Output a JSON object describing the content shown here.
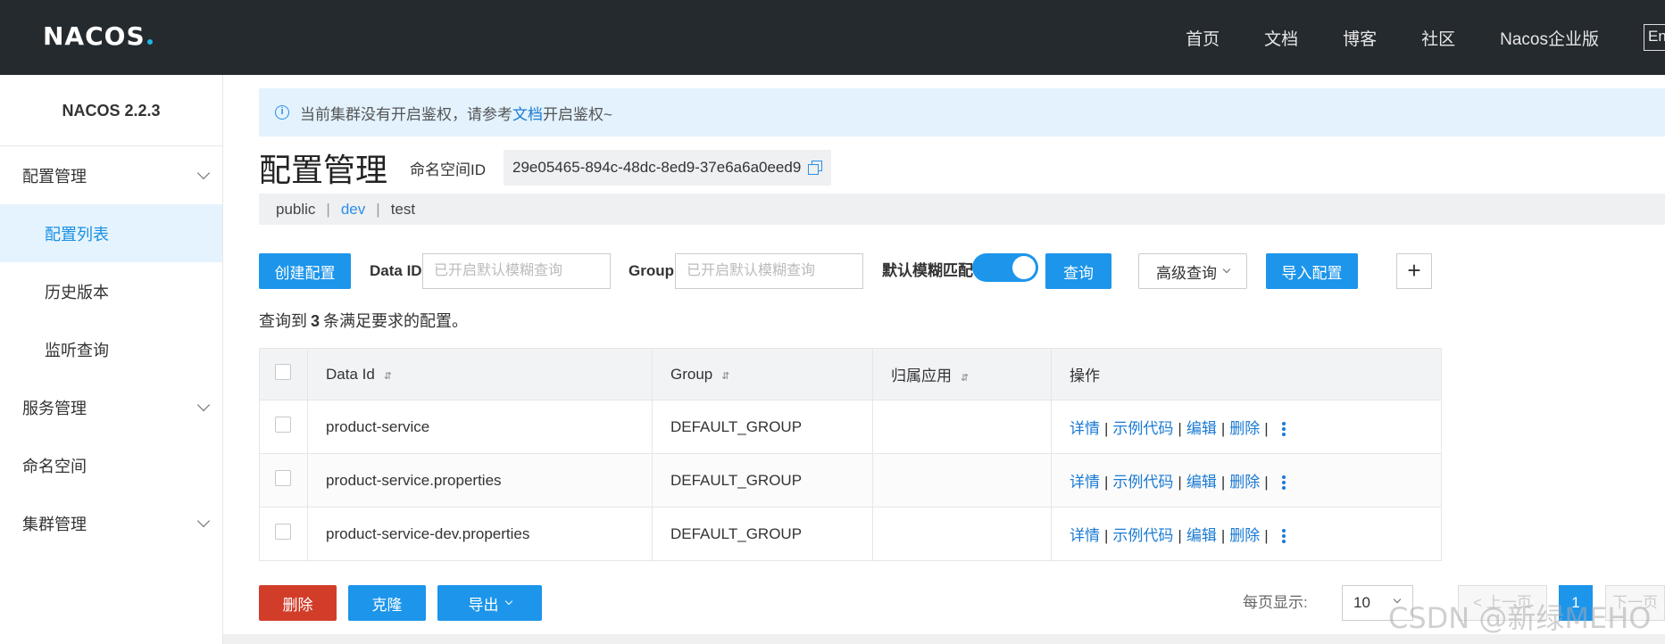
{
  "header": {
    "logo": "NACOS",
    "nav": [
      "首页",
      "文档",
      "博客",
      "社区",
      "Nacos企业版"
    ],
    "lang": "En"
  },
  "sidebar": {
    "version": "NACOS 2.2.3",
    "items": [
      {
        "label": "配置管理",
        "expandable": true
      },
      {
        "label": "配置列表",
        "sub": true,
        "active": true
      },
      {
        "label": "历史版本",
        "sub": true
      },
      {
        "label": "监听查询",
        "sub": true
      },
      {
        "label": "服务管理",
        "expandable": true
      },
      {
        "label": "命名空间"
      },
      {
        "label": "集群管理",
        "expandable": true
      }
    ]
  },
  "notice": {
    "prefix": "当前集群没有开启鉴权，请参考",
    "link": "文档",
    "suffix": "开启鉴权~"
  },
  "page": {
    "title": "配置管理",
    "namespace_label": "命名空间ID",
    "namespace_id": "29e05465-894c-48dc-8ed9-37e6a6a0eed9"
  },
  "namespaces": {
    "tabs": [
      "public",
      "dev",
      "test"
    ],
    "active": "dev"
  },
  "toolbar": {
    "create_label": "创建配置",
    "dataid_label": "Data ID",
    "dataid_placeholder": "已开启默认模糊查询",
    "group_label": "Group",
    "group_placeholder": "已开启默认模糊查询",
    "fuzzy_label": "默认模糊匹配",
    "fuzzy_on": true,
    "query_label": "查询",
    "advanced_label": "高级查询",
    "import_label": "导入配置",
    "plus": "+"
  },
  "result": {
    "prefix": "查询到",
    "count": "3",
    "suffix": "条满足要求的配置。"
  },
  "table": {
    "headers": [
      "Data Id",
      "Group",
      "归属应用",
      "操作"
    ],
    "sort_icon": "⇵",
    "rows": [
      {
        "data_id": "product-service",
        "group": "DEFAULT_GROUP",
        "app": ""
      },
      {
        "data_id": "product-service.properties",
        "group": "DEFAULT_GROUP",
        "app": ""
      },
      {
        "data_id": "product-service-dev.properties",
        "group": "DEFAULT_GROUP",
        "app": ""
      }
    ],
    "ops": [
      "详情",
      "示例代码",
      "编辑",
      "删除"
    ],
    "op_sep": "|"
  },
  "bottom": {
    "delete_label": "删除",
    "clone_label": "克隆",
    "export_label": "导出",
    "page_size_label": "每页显示:",
    "page_size": "10",
    "prev_label": "< 上一页",
    "current_page": "1",
    "next_label": "下一页 >"
  },
  "watermark": "CSDN @新绿MEHO",
  "colors": {
    "primary": "#1c95eb",
    "danger": "#d23d2a",
    "topbar": "#252a2f",
    "link": "#1a7ad4"
  }
}
